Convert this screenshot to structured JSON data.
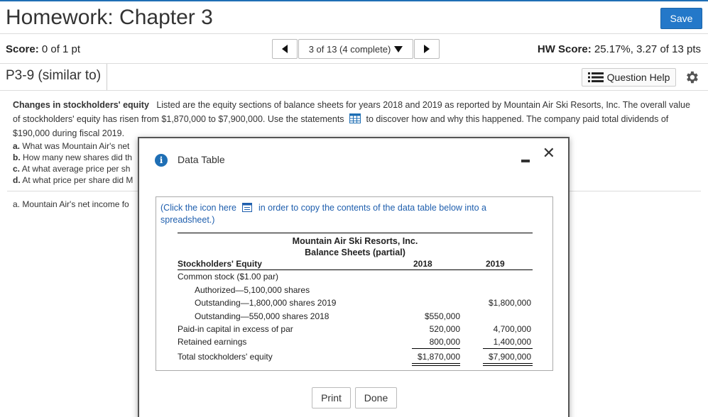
{
  "header": {
    "title": "Homework: Chapter 3",
    "save_label": "Save"
  },
  "score_bar": {
    "score_label": "Score:",
    "score_value": "0 of 1 pt",
    "nav_text": "3 of 13 (4 complete)",
    "hw_label": "HW Score:",
    "hw_value": "25.17%, 3.27 of 13 pts"
  },
  "problem_bar": {
    "problem_id": "P3-9 (similar to)",
    "help_label": "Question Help"
  },
  "content": {
    "lead": "Changes in stockholders' equity",
    "text1": "Listed are the equity sections of balance sheets for years 2018 and 2019 as reported by Mountain Air Ski Resorts, Inc. The overall value of stockholders' equity has risen from $1,870,000 to $7,900,000.  Use the statements",
    "text2": "to discover how and why this happened. The company paid total dividends of $190,000 during fiscal 2019.",
    "questions": [
      {
        "letter": "a.",
        "text": "What was Mountain Air's net"
      },
      {
        "letter": "b.",
        "text": "How many new shares did th"
      },
      {
        "letter": "c.",
        "text": "At what average price per sh"
      },
      {
        "letter": "d.",
        "text": "At what price per share did M"
      }
    ],
    "answer_line": "a. Mountain Air's net income fo"
  },
  "modal": {
    "title": "Data Table",
    "copy_note_pre": "(Click the icon here",
    "copy_note_post": "in order to copy the contents of the data table below into a spreadsheet.)",
    "print_label": "Print",
    "done_label": "Done"
  },
  "balance_sheet": {
    "company": "Mountain Air Ski Resorts, Inc.",
    "subtitle": "Balance Sheets (partial)",
    "col_header": "Stockholders' Equity",
    "col_2018": "2018",
    "col_2019": "2019",
    "rows": [
      {
        "label": "Common stock ($1.00 par)",
        "v2018": "",
        "v2019": ""
      },
      {
        "label": "Authorized—5,100,000 shares",
        "v2018": "",
        "v2019": ""
      },
      {
        "label": "Outstanding—1,800,000 shares 2019",
        "v2018": "",
        "v2019": "$1,800,000"
      },
      {
        "label": "Outstanding—550,000 shares 2018",
        "v2018": "$550,000",
        "v2019": ""
      },
      {
        "label": "Paid-in capital in excess of par",
        "v2018": "520,000",
        "v2019": "4,700,000"
      },
      {
        "label": "Retained earnings",
        "v2018": "800,000",
        "v2019": "1,400,000"
      },
      {
        "label": "Total stockholders' equity",
        "v2018": "$1,870,000",
        "v2019": "$7,900,000"
      }
    ]
  },
  "icons": {
    "save": "none",
    "nav_prev": "triangle-left-icon",
    "nav_next": "triangle-right-icon",
    "help": "list-icon",
    "settings": "gear-icon",
    "info": "info-icon",
    "table": "table-icon",
    "copy": "spreadsheet-icon"
  },
  "colors": {
    "accent": "#2478c9",
    "link": "#1f5fae"
  }
}
